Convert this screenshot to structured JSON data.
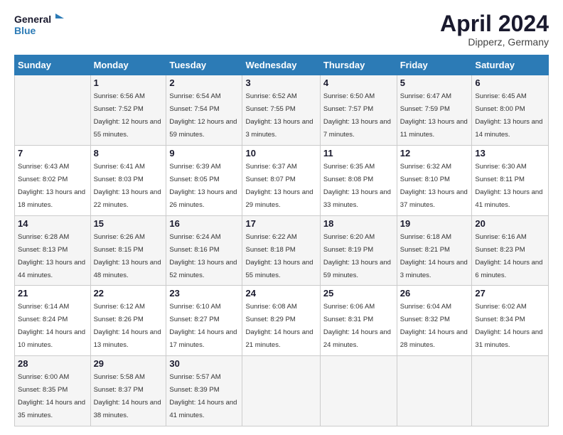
{
  "header": {
    "logo_line1": "General",
    "logo_line2": "Blue",
    "month": "April 2024",
    "location": "Dipperz, Germany"
  },
  "days": [
    "Sunday",
    "Monday",
    "Tuesday",
    "Wednesday",
    "Thursday",
    "Friday",
    "Saturday"
  ],
  "weeks": [
    [
      {
        "date": "",
        "sunrise": "",
        "sunset": "",
        "daylight": ""
      },
      {
        "date": "1",
        "sunrise": "Sunrise: 6:56 AM",
        "sunset": "Sunset: 7:52 PM",
        "daylight": "Daylight: 12 hours and 55 minutes."
      },
      {
        "date": "2",
        "sunrise": "Sunrise: 6:54 AM",
        "sunset": "Sunset: 7:54 PM",
        "daylight": "Daylight: 12 hours and 59 minutes."
      },
      {
        "date": "3",
        "sunrise": "Sunrise: 6:52 AM",
        "sunset": "Sunset: 7:55 PM",
        "daylight": "Daylight: 13 hours and 3 minutes."
      },
      {
        "date": "4",
        "sunrise": "Sunrise: 6:50 AM",
        "sunset": "Sunset: 7:57 PM",
        "daylight": "Daylight: 13 hours and 7 minutes."
      },
      {
        "date": "5",
        "sunrise": "Sunrise: 6:47 AM",
        "sunset": "Sunset: 7:59 PM",
        "daylight": "Daylight: 13 hours and 11 minutes."
      },
      {
        "date": "6",
        "sunrise": "Sunrise: 6:45 AM",
        "sunset": "Sunset: 8:00 PM",
        "daylight": "Daylight: 13 hours and 14 minutes."
      }
    ],
    [
      {
        "date": "7",
        "sunrise": "Sunrise: 6:43 AM",
        "sunset": "Sunset: 8:02 PM",
        "daylight": "Daylight: 13 hours and 18 minutes."
      },
      {
        "date": "8",
        "sunrise": "Sunrise: 6:41 AM",
        "sunset": "Sunset: 8:03 PM",
        "daylight": "Daylight: 13 hours and 22 minutes."
      },
      {
        "date": "9",
        "sunrise": "Sunrise: 6:39 AM",
        "sunset": "Sunset: 8:05 PM",
        "daylight": "Daylight: 13 hours and 26 minutes."
      },
      {
        "date": "10",
        "sunrise": "Sunrise: 6:37 AM",
        "sunset": "Sunset: 8:07 PM",
        "daylight": "Daylight: 13 hours and 29 minutes."
      },
      {
        "date": "11",
        "sunrise": "Sunrise: 6:35 AM",
        "sunset": "Sunset: 8:08 PM",
        "daylight": "Daylight: 13 hours and 33 minutes."
      },
      {
        "date": "12",
        "sunrise": "Sunrise: 6:32 AM",
        "sunset": "Sunset: 8:10 PM",
        "daylight": "Daylight: 13 hours and 37 minutes."
      },
      {
        "date": "13",
        "sunrise": "Sunrise: 6:30 AM",
        "sunset": "Sunset: 8:11 PM",
        "daylight": "Daylight: 13 hours and 41 minutes."
      }
    ],
    [
      {
        "date": "14",
        "sunrise": "Sunrise: 6:28 AM",
        "sunset": "Sunset: 8:13 PM",
        "daylight": "Daylight: 13 hours and 44 minutes."
      },
      {
        "date": "15",
        "sunrise": "Sunrise: 6:26 AM",
        "sunset": "Sunset: 8:15 PM",
        "daylight": "Daylight: 13 hours and 48 minutes."
      },
      {
        "date": "16",
        "sunrise": "Sunrise: 6:24 AM",
        "sunset": "Sunset: 8:16 PM",
        "daylight": "Daylight: 13 hours and 52 minutes."
      },
      {
        "date": "17",
        "sunrise": "Sunrise: 6:22 AM",
        "sunset": "Sunset: 8:18 PM",
        "daylight": "Daylight: 13 hours and 55 minutes."
      },
      {
        "date": "18",
        "sunrise": "Sunrise: 6:20 AM",
        "sunset": "Sunset: 8:19 PM",
        "daylight": "Daylight: 13 hours and 59 minutes."
      },
      {
        "date": "19",
        "sunrise": "Sunrise: 6:18 AM",
        "sunset": "Sunset: 8:21 PM",
        "daylight": "Daylight: 14 hours and 3 minutes."
      },
      {
        "date": "20",
        "sunrise": "Sunrise: 6:16 AM",
        "sunset": "Sunset: 8:23 PM",
        "daylight": "Daylight: 14 hours and 6 minutes."
      }
    ],
    [
      {
        "date": "21",
        "sunrise": "Sunrise: 6:14 AM",
        "sunset": "Sunset: 8:24 PM",
        "daylight": "Daylight: 14 hours and 10 minutes."
      },
      {
        "date": "22",
        "sunrise": "Sunrise: 6:12 AM",
        "sunset": "Sunset: 8:26 PM",
        "daylight": "Daylight: 14 hours and 13 minutes."
      },
      {
        "date": "23",
        "sunrise": "Sunrise: 6:10 AM",
        "sunset": "Sunset: 8:27 PM",
        "daylight": "Daylight: 14 hours and 17 minutes."
      },
      {
        "date": "24",
        "sunrise": "Sunrise: 6:08 AM",
        "sunset": "Sunset: 8:29 PM",
        "daylight": "Daylight: 14 hours and 21 minutes."
      },
      {
        "date": "25",
        "sunrise": "Sunrise: 6:06 AM",
        "sunset": "Sunset: 8:31 PM",
        "daylight": "Daylight: 14 hours and 24 minutes."
      },
      {
        "date": "26",
        "sunrise": "Sunrise: 6:04 AM",
        "sunset": "Sunset: 8:32 PM",
        "daylight": "Daylight: 14 hours and 28 minutes."
      },
      {
        "date": "27",
        "sunrise": "Sunrise: 6:02 AM",
        "sunset": "Sunset: 8:34 PM",
        "daylight": "Daylight: 14 hours and 31 minutes."
      }
    ],
    [
      {
        "date": "28",
        "sunrise": "Sunrise: 6:00 AM",
        "sunset": "Sunset: 8:35 PM",
        "daylight": "Daylight: 14 hours and 35 minutes."
      },
      {
        "date": "29",
        "sunrise": "Sunrise: 5:58 AM",
        "sunset": "Sunset: 8:37 PM",
        "daylight": "Daylight: 14 hours and 38 minutes."
      },
      {
        "date": "30",
        "sunrise": "Sunrise: 5:57 AM",
        "sunset": "Sunset: 8:39 PM",
        "daylight": "Daylight: 14 hours and 41 minutes."
      },
      {
        "date": "",
        "sunrise": "",
        "sunset": "",
        "daylight": ""
      },
      {
        "date": "",
        "sunrise": "",
        "sunset": "",
        "daylight": ""
      },
      {
        "date": "",
        "sunrise": "",
        "sunset": "",
        "daylight": ""
      },
      {
        "date": "",
        "sunrise": "",
        "sunset": "",
        "daylight": ""
      }
    ]
  ]
}
